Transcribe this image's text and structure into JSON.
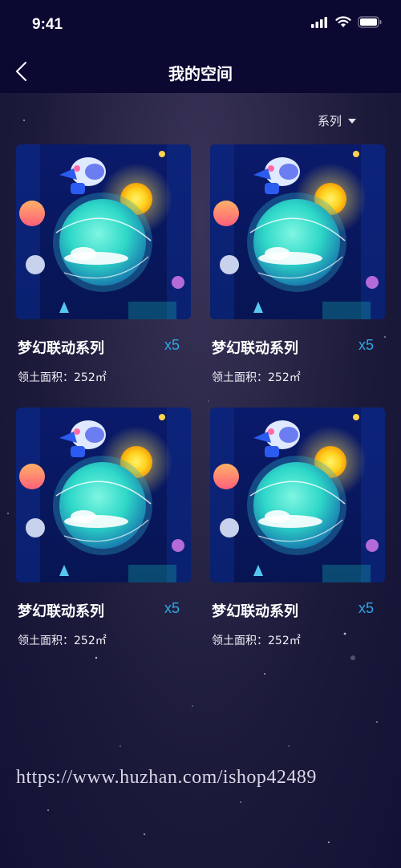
{
  "status": {
    "time": "9:41"
  },
  "header": {
    "title": "我的空间"
  },
  "filter": {
    "label": "系列"
  },
  "cards": [
    {
      "name": "梦幻联动系列",
      "quantity": "x5",
      "area": "领土面积：252㎡"
    },
    {
      "name": "梦幻联动系列",
      "quantity": "x5",
      "area": "领土面积：252㎡"
    },
    {
      "name": "梦幻联动系列",
      "quantity": "x5",
      "area": "领土面积：252㎡"
    },
    {
      "name": "梦幻联动系列",
      "quantity": "x5",
      "area": "领土面积：252㎡"
    }
  ],
  "watermark": "https://www.huzhan.com/ishop42489",
  "colors": {
    "quantity_accent": "#2ba8e6",
    "header_bg": "#0b0932",
    "background": "#1c1a3a"
  },
  "icons": [
    "signal-icon",
    "wifi-icon",
    "battery-icon",
    "back-arrow-icon",
    "caret-down-icon"
  ]
}
